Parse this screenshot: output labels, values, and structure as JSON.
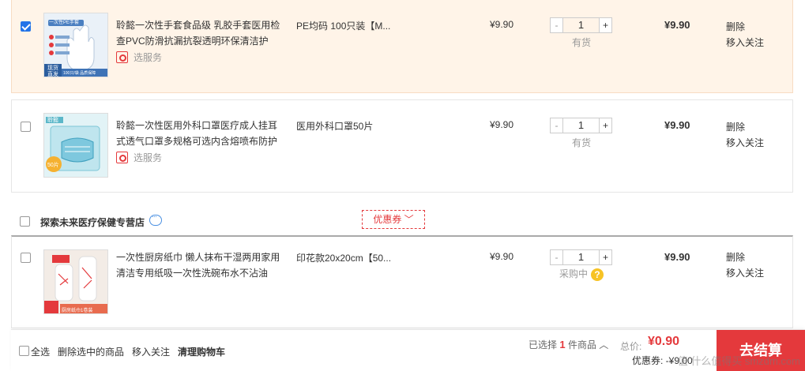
{
  "items": [
    {
      "checked": true,
      "title": "聆懿一次性手套食品级 乳胶手套医用检查PVC防滑抗漏抗裂透明环保清洁护",
      "service": "选服务",
      "spec": "PE均码 100只装【M...",
      "price": "¥9.90",
      "qty_minus": "-",
      "qty": "1",
      "qty_plus": "+",
      "stock": "有货",
      "subtotal": "¥9.90",
      "op_delete": "删除",
      "op_follow": "移入关注"
    },
    {
      "checked": false,
      "title": "聆懿一次性医用外科口罩医疗成人挂耳式透气口罩多规格可选内含熔喷布防护",
      "service": "选服务",
      "spec": "医用外科口罩50片",
      "price": "¥9.90",
      "qty_minus": "-",
      "qty": "1",
      "qty_plus": "+",
      "stock": "有货",
      "subtotal": "¥9.90",
      "op_delete": "删除",
      "op_follow": "移入关注"
    },
    {
      "checked": false,
      "title": "一次性厨房纸巾 懒人抹布干湿两用家用清洁专用纸吸一次性洗碗布水不沾油",
      "spec": "印花款20x20cm【50...",
      "price": "¥9.90",
      "qty_minus": "-",
      "qty": "1",
      "qty_plus": "+",
      "stock": "采购中",
      "subtotal": "¥9.90",
      "op_delete": "删除",
      "op_follow": "移入关注"
    }
  ],
  "shop": {
    "name": "探索未来医疗保健专营店",
    "coupon_label": "优惠券 ﹀"
  },
  "bottom_bar": {
    "select_all": "全选",
    "delete_selected": "删除选中的商品",
    "move_to_follow": "移入关注",
    "clear_cart": "清理购物车",
    "selected_prefix": "已选择",
    "selected_count": "1",
    "selected_suffix": "件商品 ︿",
    "total_label": "总价:",
    "total_value": "¥0.90",
    "coupon_label": "优惠券: -¥9.00",
    "checkout_label": "去结算"
  },
  "thumb_texts": {
    "glove_badge": "一次性PE手套",
    "glove_caption": "100只/袋 品质保障",
    "glove_tag": "现货直发",
    "mask_brand": "聆懿",
    "mask_tag": "50片",
    "paper_tag": "厨房纸巾1卷装"
  },
  "watermark": "值 什么值得买 smzdm.com",
  "colors": {
    "accent_red": "#e4393c",
    "checked_blue": "#2374e8",
    "selected_row_bg": "#fff4e8"
  }
}
